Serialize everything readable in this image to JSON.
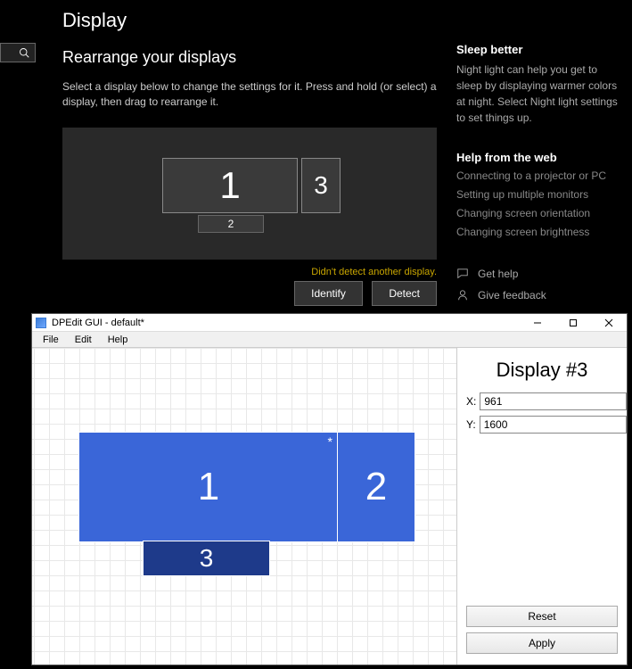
{
  "settings": {
    "page_title": "Display",
    "section_title": "Rearrange your displays",
    "description": "Select a display below to change the settings for it. Press and hold (or select) a display, then drag to rearrange it.",
    "displays": {
      "d1": "1",
      "d2": "2",
      "d3": "3"
    },
    "detect_msg": "Didn't detect another display.",
    "identify_label": "Identify",
    "detect_label": "Detect"
  },
  "sidebar": {
    "sleep_heading": "Sleep better",
    "sleep_text": "Night light can help you get to sleep by displaying warmer colors at night. Select Night light settings to set things up.",
    "help_heading": "Help from the web",
    "links": {
      "l1": "Connecting to a projector or PC",
      "l2": "Setting up multiple monitors",
      "l3": "Changing screen orientation",
      "l4": "Changing screen brightness"
    },
    "get_help": "Get help",
    "give_feedback": "Give feedback"
  },
  "dpedit": {
    "title": "DPEdit GUI - default*",
    "menu": {
      "file": "File",
      "edit": "Edit",
      "help": "Help"
    },
    "displays": {
      "d1": "1",
      "d2": "2",
      "d3": "3"
    },
    "star": "*",
    "panel_title": "Display #3",
    "x_label": "X:",
    "y_label": "Y:",
    "x_value": "961",
    "y_value": "1600",
    "reset_label": "Reset",
    "apply_label": "Apply"
  }
}
